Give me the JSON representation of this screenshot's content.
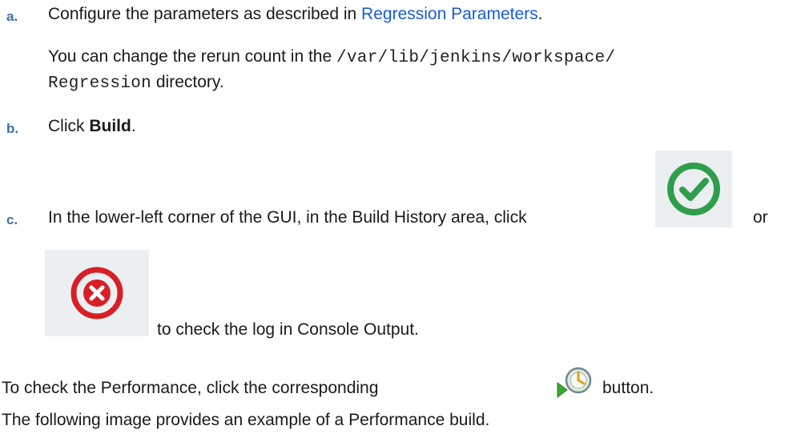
{
  "steps": [
    {
      "letter": "a.",
      "text_before_link": "Configure the parameters as described in ",
      "link_text": "Regression Parameters",
      "text_after_link": ".",
      "note_before": "You can change the rerun count in the ",
      "note_code_1": "/var/lib/jenkins/workspace/",
      "note_code_2": "Regression",
      "note_after": " directory."
    },
    {
      "letter": "b.",
      "text_before": "Click ",
      "bold": "Build",
      "text_after": "."
    },
    {
      "letter": "c.",
      "text_before": "In the lower-left corner of the GUI, in the Build History area, click",
      "or_text": "or",
      "text_after": "to check the log in Console Output.",
      "success_icon": "check-circle-icon",
      "failure_icon": "x-circle-icon"
    }
  ],
  "performance_line": {
    "before": "To check the Performance, click the corresponding",
    "after": "button.",
    "icon": "performance-icon"
  },
  "example_line": "The following image provides an example of a Performance build.",
  "colors": {
    "success": "#2e9e4a",
    "failure": "#d81f26",
    "link": "#1a5ae0",
    "step_letter": "#3b6fa8"
  }
}
